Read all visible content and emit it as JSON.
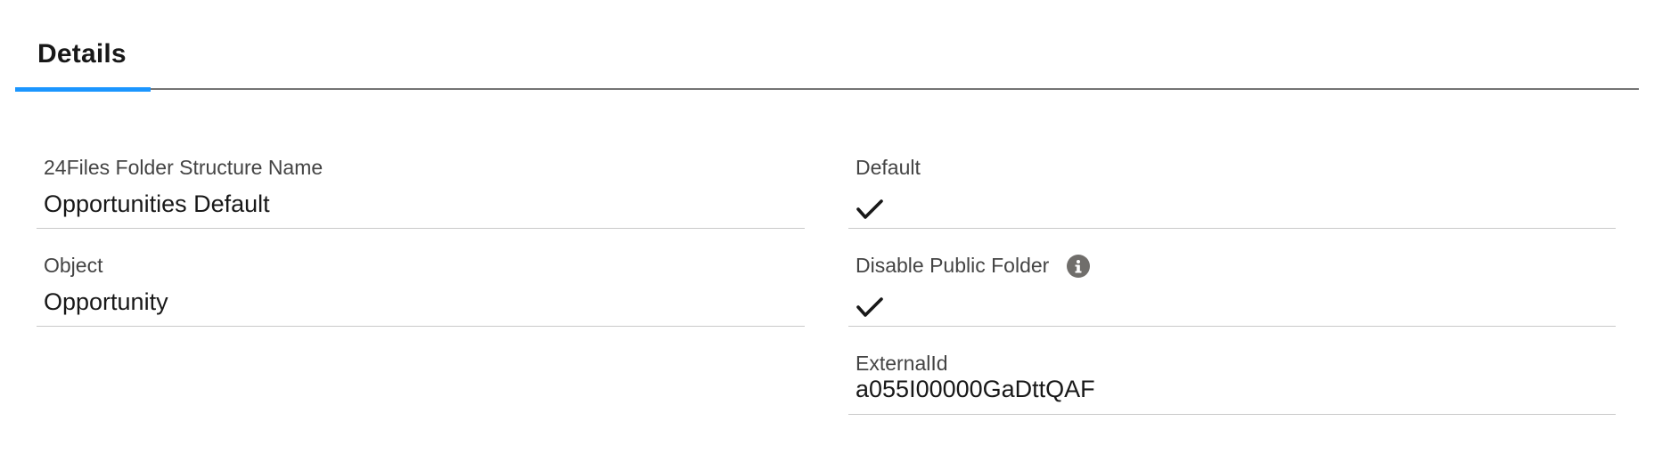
{
  "tabs": {
    "active_label": "Details"
  },
  "fields": {
    "folder_structure_name": {
      "label": "24Files Folder Structure Name",
      "value": "Opportunities Default"
    },
    "object": {
      "label": "Object",
      "value": "Opportunity"
    },
    "default": {
      "label": "Default",
      "checked": true
    },
    "disable_public_folder": {
      "label": "Disable Public Folder",
      "checked": true,
      "help_icon": "info-icon"
    },
    "external_id": {
      "label": "ExternalId",
      "value": "a055I00000GaDttQAF"
    }
  },
  "colors": {
    "active_tab_underline": "#1b96ff",
    "tab_border": "#747474",
    "field_divider": "#c9c9c9",
    "label_text": "#444444",
    "value_text": "#181818",
    "info_icon_bg": "#706e6b"
  }
}
